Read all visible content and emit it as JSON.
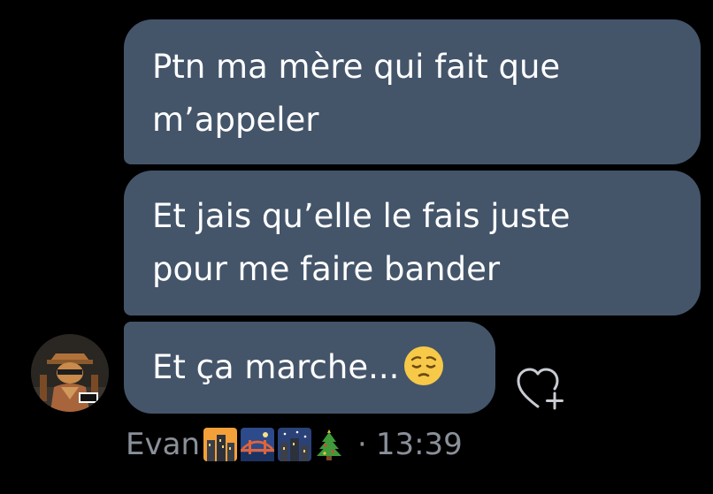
{
  "messages": [
    {
      "lines": [
        "Ptn ma mère qui fait que",
        "m’appeler"
      ]
    },
    {
      "lines": [
        "Et jais qu’elle le fais juste",
        "pour me faire bander"
      ]
    },
    {
      "text": "Et ça marche...",
      "emoji": "pensive-face"
    }
  ],
  "sender": {
    "name": "Evan",
    "flair_emojis": [
      "city-sunrise",
      "bridge-at-night",
      "night-with-stars",
      "christmas-tree"
    ],
    "separator": "·",
    "time": "13:39"
  },
  "reaction": {
    "icon": "heart-plus-icon"
  },
  "colors": {
    "background": "#000000",
    "bubble": "#44556a",
    "text": "#ffffff",
    "meta": "#8a9099"
  }
}
